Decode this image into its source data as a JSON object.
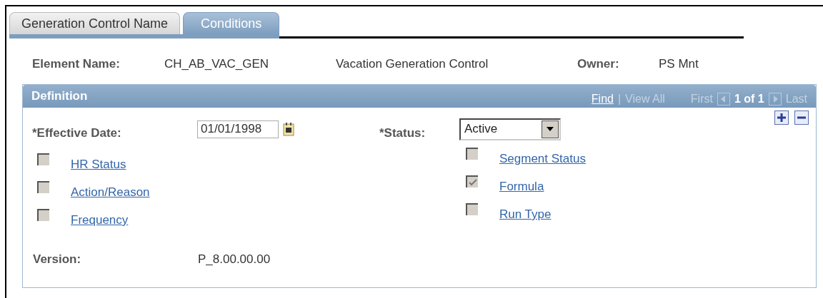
{
  "tabs": [
    {
      "label": "Generation Control Name",
      "selected": false
    },
    {
      "label": "Conditions",
      "selected": true
    }
  ],
  "element": {
    "name_label": "Element Name:",
    "name_value": "CH_AB_VAC_GEN",
    "description": "Vacation Generation Control",
    "owner_label": "Owner:",
    "owner_value": "PS Mnt"
  },
  "definition": {
    "title": "Definition",
    "nav": {
      "find": "Find",
      "separator": "|",
      "view_all": "View All",
      "first": "First",
      "counter": "1 of 1",
      "last": "Last"
    },
    "effective_date": {
      "label": "*Effective Date:",
      "value": "01/01/1998"
    },
    "status": {
      "label": "*Status:",
      "value": "Active"
    },
    "left_checks": [
      {
        "label": "HR Status",
        "checked": false
      },
      {
        "label": "Action/Reason",
        "checked": false
      },
      {
        "label": "Frequency",
        "checked": false
      }
    ],
    "right_checks": [
      {
        "label": "Segment Status",
        "checked": false
      },
      {
        "label": "Formula",
        "checked": true
      },
      {
        "label": "Run Type",
        "checked": false
      }
    ],
    "version": {
      "label": "Version:",
      "value": "P_8.00.00.00"
    }
  }
}
